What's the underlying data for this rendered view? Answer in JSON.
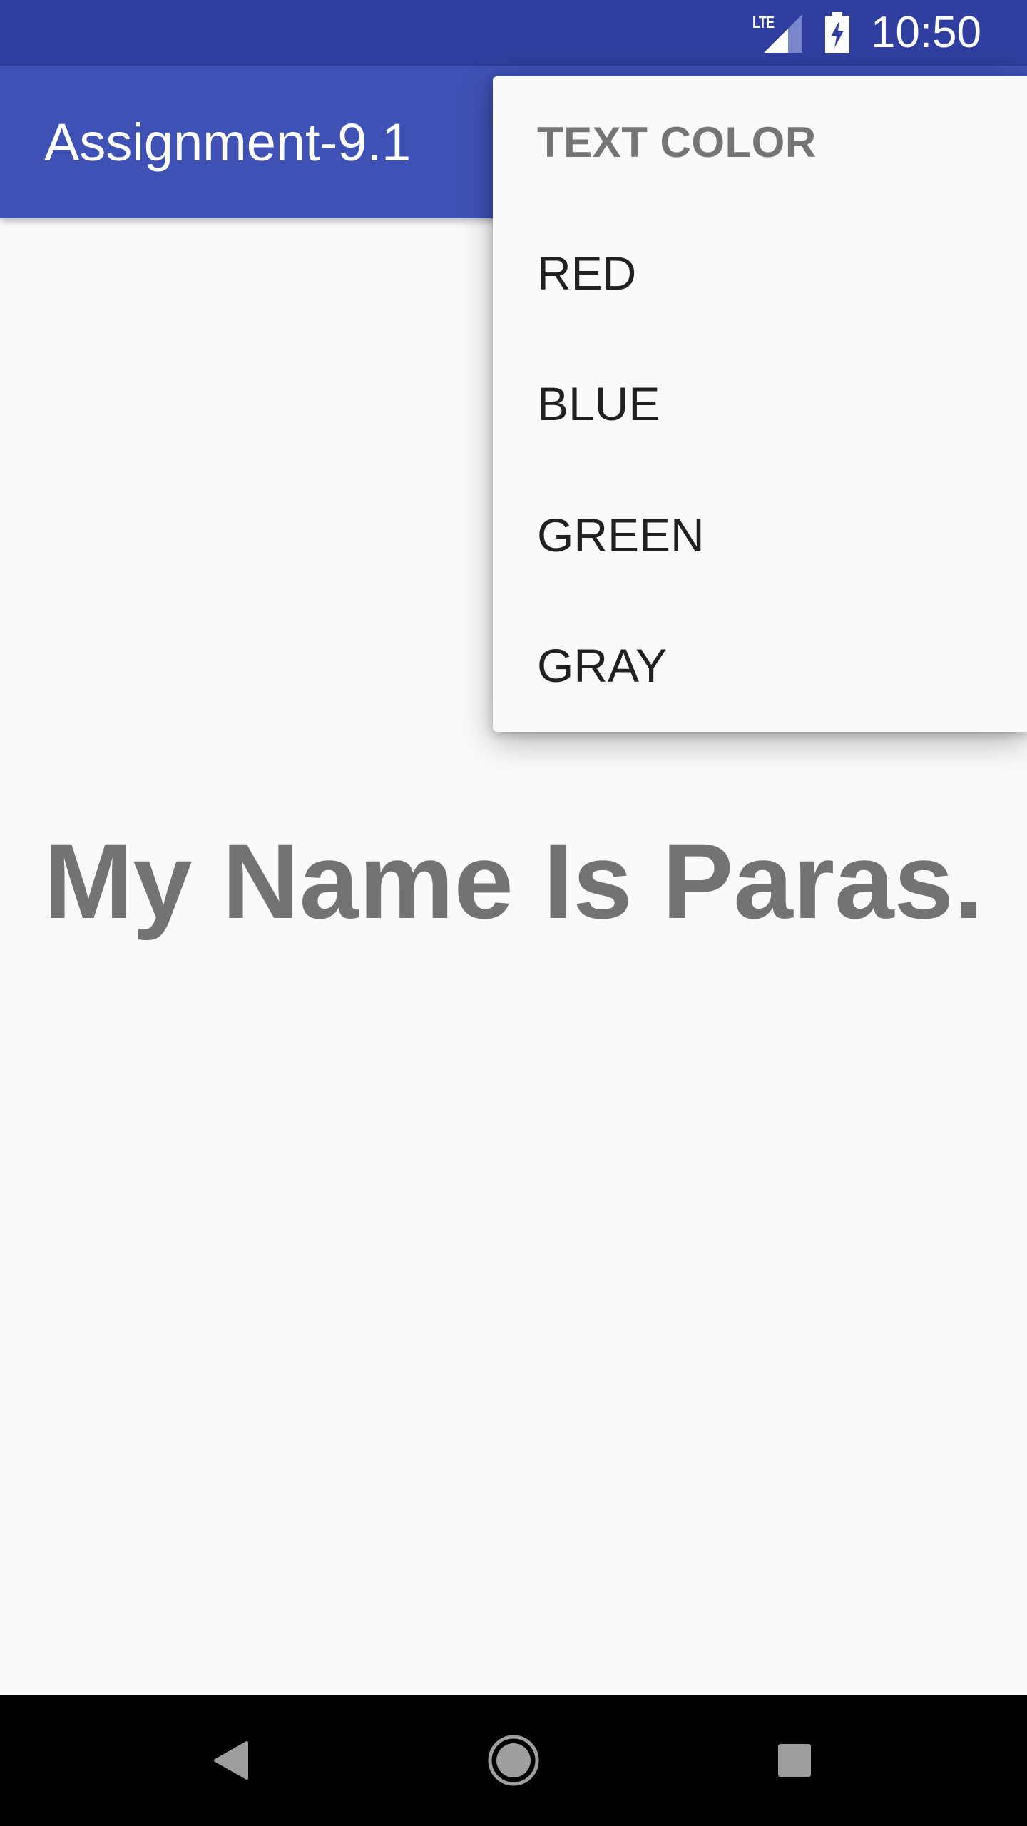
{
  "status_bar": {
    "network_label": "LTE",
    "clock": "10:50",
    "background_color": "#303f9f",
    "icons": [
      "signal-icon",
      "battery-charging-icon"
    ]
  },
  "app_bar": {
    "title": "Assignment-9.1",
    "background_color": "#3f51b5"
  },
  "content": {
    "main_text": "My Name Is Paras.",
    "text_color": "#737373"
  },
  "overflow_menu": {
    "header": "TEXT COLOR",
    "items": [
      {
        "label": "RED"
      },
      {
        "label": "BLUE"
      },
      {
        "label": "GREEN"
      },
      {
        "label": "GRAY"
      }
    ]
  },
  "nav_bar": {
    "icons": [
      "back-icon",
      "home-icon",
      "recents-icon"
    ]
  }
}
